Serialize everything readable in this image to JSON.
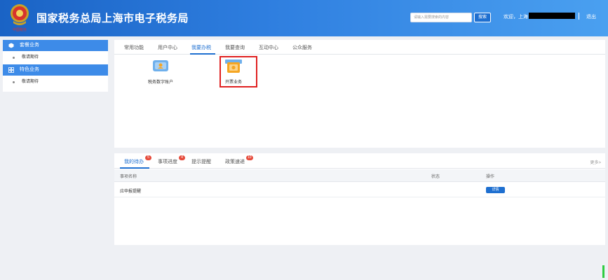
{
  "header": {
    "title": "国家税务总局上海市电子税务局",
    "emblem_caption": "中国税务",
    "search_placeholder": "请输入需要搜索的内容",
    "search_button": "搜索",
    "welcome": "欢迎，上海",
    "logout": "退出"
  },
  "sidebar": {
    "sections": [
      {
        "title": "套餐业务",
        "icon": "cube-icon",
        "items": [
          "敬请期待"
        ]
      },
      {
        "title": "特色业务",
        "icon": "grid-icon",
        "items": [
          "敬请期待"
        ]
      }
    ]
  },
  "main": {
    "tabs": [
      "常用功能",
      "用户中心",
      "我要办税",
      "我要查询",
      "互动中心",
      "公众服务"
    ],
    "active_tab": "我要办税",
    "apps": [
      {
        "label": "税务数字账户",
        "icon": "digital-account-icon"
      },
      {
        "label": "开票业务",
        "icon": "invoice-icon"
      }
    ]
  },
  "todo": {
    "tabs": [
      {
        "label": "我的待办",
        "badge": "5"
      },
      {
        "label": "事项进度",
        "badge": "4"
      },
      {
        "label": "提示提醒",
        "badge": ""
      },
      {
        "label": "政策速递",
        "badge": "10"
      }
    ],
    "more": "更多>",
    "columns": [
      "事项名称",
      "状态",
      "操作"
    ],
    "rows": [
      {
        "name": "应申报提醒",
        "status": "",
        "action": "详情"
      }
    ]
  },
  "colors": {
    "primary": "#1e6fd0",
    "highlight": "#e02020",
    "badge": "#e64b3c"
  }
}
